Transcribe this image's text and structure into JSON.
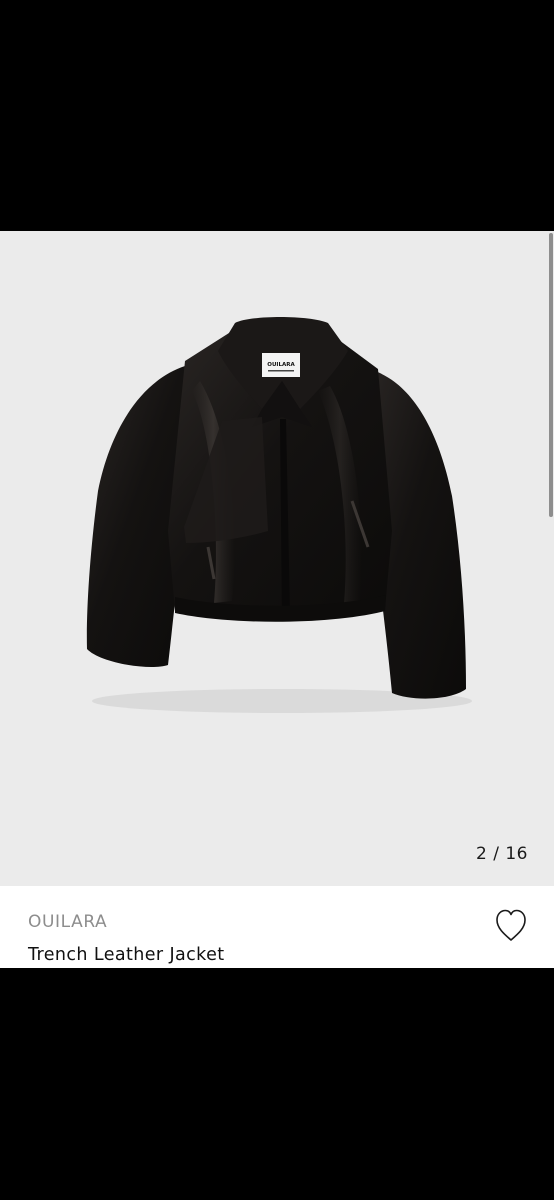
{
  "gallery": {
    "counter": "2 / 16",
    "image_alt": "Trench Leather Jacket",
    "label_brand": "OUILARA"
  },
  "product": {
    "brand": "OUILARA",
    "name": "Trench Leather Jacket"
  },
  "icons": {
    "wishlist": "heart-outline-icon"
  },
  "colors": {
    "gallery_bg": "#ebebeb",
    "brand_text": "#8d8d8d",
    "name_text": "#111111"
  }
}
